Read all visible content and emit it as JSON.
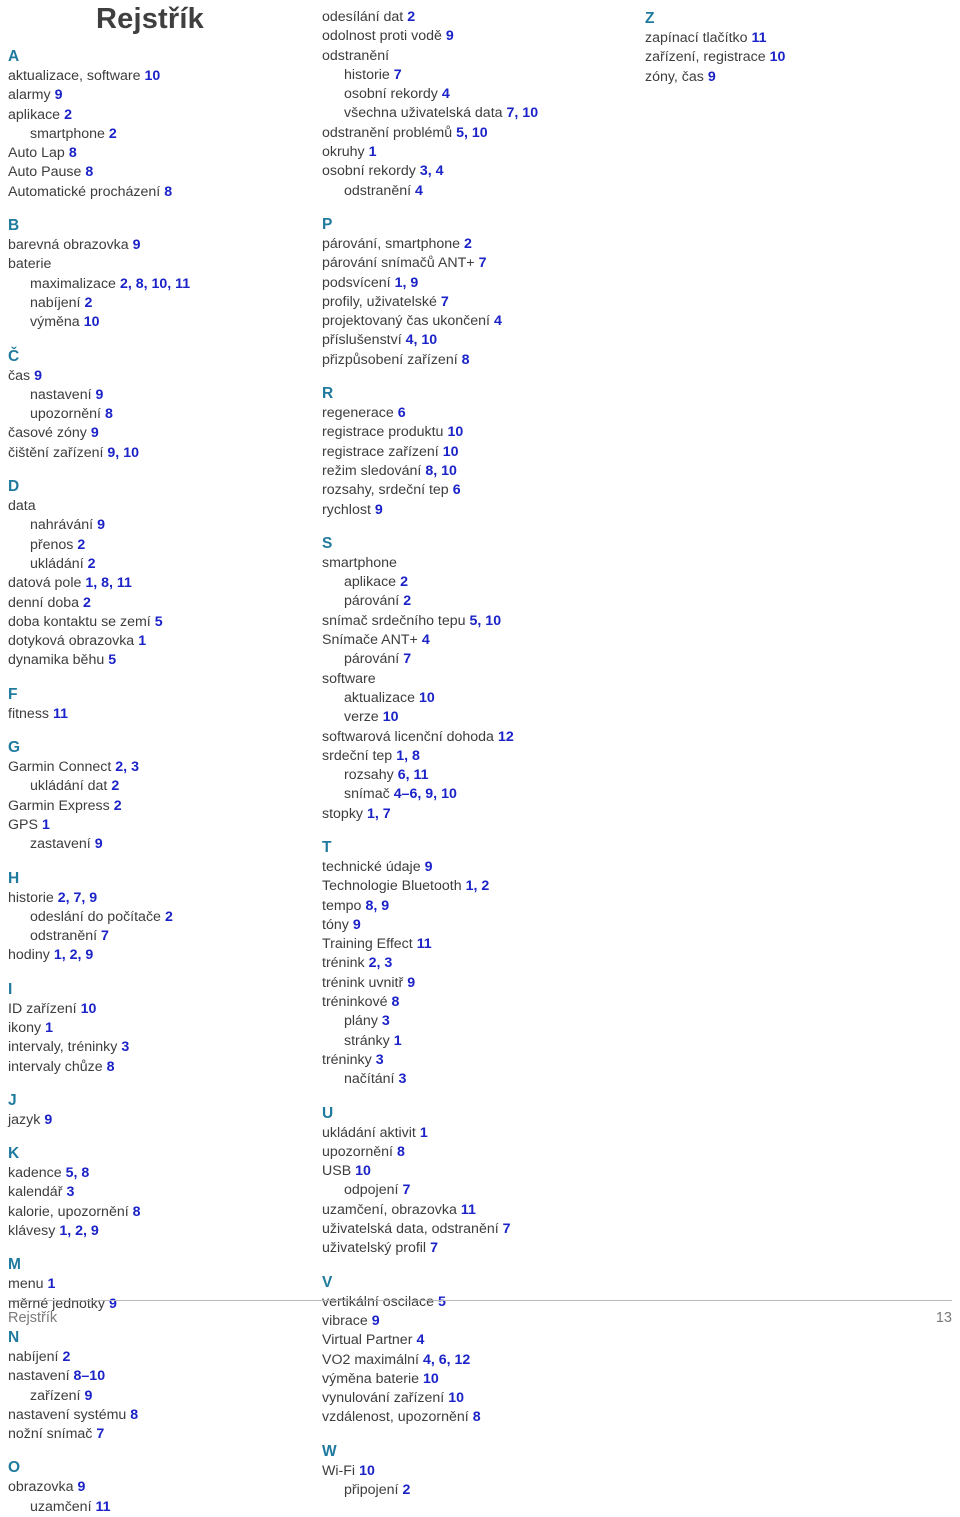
{
  "title": "Rejstřík",
  "footer": {
    "left_label": "Rejstřík",
    "page_number": "13"
  },
  "columns": [
    {
      "id": "column-1",
      "groups": [
        {
          "letter": "A",
          "entries": [
            {
              "text": "aktualizace, software",
              "pages": "10",
              "level": 0
            },
            {
              "text": "alarmy",
              "pages": "9",
              "level": 0
            },
            {
              "text": "aplikace",
              "pages": "2",
              "level": 0
            },
            {
              "text": "smartphone",
              "pages": "2",
              "level": 1
            },
            {
              "text": "Auto Lap",
              "pages": "8",
              "level": 0
            },
            {
              "text": "Auto Pause",
              "pages": "8",
              "level": 0
            },
            {
              "text": "Automatické procházení",
              "pages": "8",
              "level": 0
            }
          ]
        },
        {
          "letter": "B",
          "entries": [
            {
              "text": "barevná obrazovka",
              "pages": "9",
              "level": 0
            },
            {
              "text": "baterie",
              "pages": "",
              "level": 0
            },
            {
              "text": "maximalizace",
              "pages": "2, 8, 10, 11",
              "level": 1
            },
            {
              "text": "nabíjení",
              "pages": "2",
              "level": 1
            },
            {
              "text": "výměna",
              "pages": "10",
              "level": 1
            }
          ]
        },
        {
          "letter": "Č",
          "entries": [
            {
              "text": "čas",
              "pages": "9",
              "level": 0
            },
            {
              "text": "nastavení",
              "pages": "9",
              "level": 1
            },
            {
              "text": "upozornění",
              "pages": "8",
              "level": 1
            },
            {
              "text": "časové zóny",
              "pages": "9",
              "level": 0
            },
            {
              "text": "čištění zařízení",
              "pages": "9, 10",
              "level": 0
            }
          ]
        },
        {
          "letter": "D",
          "entries": [
            {
              "text": "data",
              "pages": "",
              "level": 0
            },
            {
              "text": "nahrávání",
              "pages": "9",
              "level": 1
            },
            {
              "text": "přenos",
              "pages": "2",
              "level": 1
            },
            {
              "text": "ukládání",
              "pages": "2",
              "level": 1
            },
            {
              "text": "datová pole",
              "pages": "1, 8, 11",
              "level": 0
            },
            {
              "text": "denní doba",
              "pages": "2",
              "level": 0
            },
            {
              "text": "doba kontaktu se zemí",
              "pages": "5",
              "level": 0
            },
            {
              "text": "dotyková obrazovka",
              "pages": "1",
              "level": 0
            },
            {
              "text": "dynamika běhu",
              "pages": "5",
              "level": 0
            }
          ]
        },
        {
          "letter": "F",
          "entries": [
            {
              "text": "fitness",
              "pages": "11",
              "level": 0
            }
          ]
        },
        {
          "letter": "G",
          "entries": [
            {
              "text": "Garmin Connect",
              "pages": "2, 3",
              "level": 0
            },
            {
              "text": "ukládání dat",
              "pages": "2",
              "level": 1
            },
            {
              "text": "Garmin Express",
              "pages": "2",
              "level": 0
            },
            {
              "text": "GPS",
              "pages": "1",
              "level": 0
            },
            {
              "text": "zastavení",
              "pages": "9",
              "level": 1
            }
          ]
        },
        {
          "letter": "H",
          "entries": [
            {
              "text": "historie",
              "pages": "2, 7, 9",
              "level": 0
            },
            {
              "text": "odeslání do počítače",
              "pages": "2",
              "level": 1
            },
            {
              "text": "odstranění",
              "pages": "7",
              "level": 1
            },
            {
              "text": "hodiny",
              "pages": "1, 2, 9",
              "level": 0
            }
          ]
        },
        {
          "letter": "I",
          "entries": [
            {
              "text": "ID zařízení",
              "pages": "10",
              "level": 0
            },
            {
              "text": "ikony",
              "pages": "1",
              "level": 0
            },
            {
              "text": "intervaly, tréninky",
              "pages": "3",
              "level": 0
            },
            {
              "text": "intervaly chůze",
              "pages": "8",
              "level": 0
            }
          ]
        },
        {
          "letter": "J",
          "entries": [
            {
              "text": "jazyk",
              "pages": "9",
              "level": 0
            }
          ]
        },
        {
          "letter": "K",
          "entries": [
            {
              "text": "kadence",
              "pages": "5, 8",
              "level": 0
            },
            {
              "text": "kalendář",
              "pages": "3",
              "level": 0
            },
            {
              "text": "kalorie, upozornění",
              "pages": "8",
              "level": 0
            },
            {
              "text": "klávesy",
              "pages": "1, 2, 9",
              "level": 0
            }
          ]
        },
        {
          "letter": "M",
          "entries": [
            {
              "text": "menu",
              "pages": "1",
              "level": 0
            },
            {
              "text": "měrné jednotky",
              "pages": "9",
              "level": 0
            }
          ]
        },
        {
          "letter": "N",
          "entries": [
            {
              "text": "nabíjení",
              "pages": "2",
              "level": 0
            },
            {
              "text": "nastavení",
              "pages": "8–10",
              "level": 0
            },
            {
              "text": "zařízení",
              "pages": "9",
              "level": 1
            },
            {
              "text": "nastavení systému",
              "pages": "8",
              "level": 0
            },
            {
              "text": "nožní snímač",
              "pages": "7",
              "level": 0
            }
          ]
        },
        {
          "letter": "O",
          "entries": [
            {
              "text": "obrazovka",
              "pages": "9",
              "level": 0
            },
            {
              "text": "uzamčení",
              "pages": "11",
              "level": 1
            }
          ]
        }
      ]
    },
    {
      "id": "column-2",
      "groups": [
        {
          "letter": "",
          "entries": [
            {
              "text": "odesílání dat",
              "pages": "2",
              "level": 0
            },
            {
              "text": "odolnost proti vodě",
              "pages": "9",
              "level": 0
            },
            {
              "text": "odstranění",
              "pages": "",
              "level": 0
            },
            {
              "text": "historie",
              "pages": "7",
              "level": 1
            },
            {
              "text": "osobní rekordy",
              "pages": "4",
              "level": 1
            },
            {
              "text": "všechna uživatelská data",
              "pages": "7, 10",
              "level": 1
            },
            {
              "text": "odstranění problémů",
              "pages": "5, 10",
              "level": 0
            },
            {
              "text": "okruhy",
              "pages": "1",
              "level": 0
            },
            {
              "text": "osobní rekordy",
              "pages": "3, 4",
              "level": 0
            },
            {
              "text": "odstranění",
              "pages": "4",
              "level": 1
            }
          ]
        },
        {
          "letter": "P",
          "entries": [
            {
              "text": "párování, smartphone",
              "pages": "2",
              "level": 0
            },
            {
              "text": "párování snímačů ANT+",
              "pages": "7",
              "level": 0
            },
            {
              "text": "podsvícení",
              "pages": "1, 9",
              "level": 0
            },
            {
              "text": "profily, uživatelské",
              "pages": "7",
              "level": 0
            },
            {
              "text": "projektovaný čas ukončení",
              "pages": "4",
              "level": 0
            },
            {
              "text": "příslušenství",
              "pages": "4, 10",
              "level": 0
            },
            {
              "text": "přizpůsobení zařízení",
              "pages": "8",
              "level": 0
            }
          ]
        },
        {
          "letter": "R",
          "entries": [
            {
              "text": "regenerace",
              "pages": "6",
              "level": 0
            },
            {
              "text": "registrace produktu",
              "pages": "10",
              "level": 0
            },
            {
              "text": "registrace zařízení",
              "pages": "10",
              "level": 0
            },
            {
              "text": "režim sledování",
              "pages": "8, 10",
              "level": 0
            },
            {
              "text": "rozsahy, srdeční tep",
              "pages": "6",
              "level": 0
            },
            {
              "text": "rychlost",
              "pages": "9",
              "level": 0
            }
          ]
        },
        {
          "letter": "S",
          "entries": [
            {
              "text": "smartphone",
              "pages": "",
              "level": 0
            },
            {
              "text": "aplikace",
              "pages": "2",
              "level": 1
            },
            {
              "text": "párování",
              "pages": "2",
              "level": 1
            },
            {
              "text": "snímač srdečního tepu",
              "pages": "5, 10",
              "level": 0
            },
            {
              "text": "Snímače ANT+",
              "pages": "4",
              "level": 0
            },
            {
              "text": "párování",
              "pages": "7",
              "level": 1
            },
            {
              "text": "software",
              "pages": "",
              "level": 0
            },
            {
              "text": "aktualizace",
              "pages": "10",
              "level": 1
            },
            {
              "text": "verze",
              "pages": "10",
              "level": 1
            },
            {
              "text": "softwarová licenční dohoda",
              "pages": "12",
              "level": 0
            },
            {
              "text": "srdeční tep",
              "pages": "1, 8",
              "level": 0
            },
            {
              "text": "rozsahy",
              "pages": "6, 11",
              "level": 1
            },
            {
              "text": "snímač",
              "pages": "4–6, 9, 10",
              "level": 1
            },
            {
              "text": "stopky",
              "pages": "1, 7",
              "level": 0
            }
          ]
        },
        {
          "letter": "T",
          "entries": [
            {
              "text": "technické údaje",
              "pages": "9",
              "level": 0
            },
            {
              "text": "Technologie Bluetooth",
              "pages": "1, 2",
              "level": 0
            },
            {
              "text": "tempo",
              "pages": "8, 9",
              "level": 0
            },
            {
              "text": "tóny",
              "pages": "9",
              "level": 0
            },
            {
              "text": "Training Effect",
              "pages": "11",
              "level": 0
            },
            {
              "text": "trénink",
              "pages": "2, 3",
              "level": 0
            },
            {
              "text": "trénink uvnitř",
              "pages": "9",
              "level": 0
            },
            {
              "text": "tréninkové",
              "pages": "8",
              "level": 0
            },
            {
              "text": "plány",
              "pages": "3",
              "level": 1
            },
            {
              "text": "stránky",
              "pages": "1",
              "level": 1
            },
            {
              "text": "tréninky",
              "pages": "3",
              "level": 0
            },
            {
              "text": "načítání",
              "pages": "3",
              "level": 1
            }
          ]
        },
        {
          "letter": "U",
          "entries": [
            {
              "text": "ukládání aktivit",
              "pages": "1",
              "level": 0
            },
            {
              "text": "upozornění",
              "pages": "8",
              "level": 0
            },
            {
              "text": "USB",
              "pages": "10",
              "level": 0
            },
            {
              "text": "odpojení",
              "pages": "7",
              "level": 1
            },
            {
              "text": "uzamčení, obrazovka",
              "pages": "11",
              "level": 0
            },
            {
              "text": "uživatelská data, odstranění",
              "pages": "7",
              "level": 0
            },
            {
              "text": "uživatelský profil",
              "pages": "7",
              "level": 0
            }
          ]
        },
        {
          "letter": "V",
          "entries": [
            {
              "text": "vertikální oscilace",
              "pages": "5",
              "level": 0
            },
            {
              "text": "vibrace",
              "pages": "9",
              "level": 0
            },
            {
              "text": "Virtual Partner",
              "pages": "4",
              "level": 0
            },
            {
              "text": "VO2 maximální",
              "pages": "4, 6, 12",
              "level": 0
            },
            {
              "text": "výměna baterie",
              "pages": "10",
              "level": 0
            },
            {
              "text": "vynulování zařízení",
              "pages": "10",
              "level": 0
            },
            {
              "text": "vzdálenost, upozornění",
              "pages": "8",
              "level": 0
            }
          ]
        },
        {
          "letter": "W",
          "entries": [
            {
              "text": "Wi-Fi",
              "pages": "10",
              "level": 0
            },
            {
              "text": "připojení",
              "pages": "2",
              "level": 1
            }
          ]
        }
      ]
    },
    {
      "id": "column-3",
      "groups": [
        {
          "letter": "Z",
          "entries": [
            {
              "text": "zapínací tlačítko",
              "pages": "11",
              "level": 0
            },
            {
              "text": "zařízení, registrace",
              "pages": "10",
              "level": 0
            },
            {
              "text": "zóny, čas",
              "pages": "9",
              "level": 0
            }
          ]
        }
      ]
    }
  ]
}
